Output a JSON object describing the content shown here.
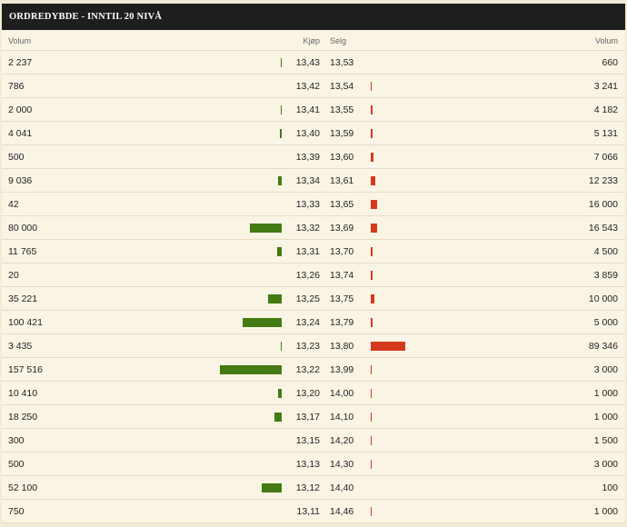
{
  "title": "ORDREDYBDE - INNTIL 20 NIVÅ",
  "headers": {
    "buy_volume": "Volum",
    "bid": "Kjøp",
    "ask": "Selg",
    "sell_volume": "Volum"
  },
  "colors": {
    "buy": "#447b12",
    "sell": "#d63a1e",
    "header_bg": "#1e1e1e",
    "row_bg": "#faf4e5"
  },
  "rows": [
    {
      "buy_volume": "2 237",
      "buy_qty": 2237,
      "bid": "13,43",
      "ask": "13,53",
      "sell_volume": "660",
      "sell_qty": 660
    },
    {
      "buy_volume": "786",
      "buy_qty": 786,
      "bid": "13,42",
      "ask": "13,54",
      "sell_volume": "3 241",
      "sell_qty": 3241
    },
    {
      "buy_volume": "2 000",
      "buy_qty": 2000,
      "bid": "13,41",
      "ask": "13,55",
      "sell_volume": "4 182",
      "sell_qty": 4182
    },
    {
      "buy_volume": "4 041",
      "buy_qty": 4041,
      "bid": "13,40",
      "ask": "13,59",
      "sell_volume": "5 131",
      "sell_qty": 5131
    },
    {
      "buy_volume": "500",
      "buy_qty": 500,
      "bid": "13,39",
      "ask": "13,60",
      "sell_volume": "7 066",
      "sell_qty": 7066
    },
    {
      "buy_volume": "9 036",
      "buy_qty": 9036,
      "bid": "13,34",
      "ask": "13,61",
      "sell_volume": "12 233",
      "sell_qty": 12233
    },
    {
      "buy_volume": "42",
      "buy_qty": 42,
      "bid": "13,33",
      "ask": "13,65",
      "sell_volume": "16 000",
      "sell_qty": 16000
    },
    {
      "buy_volume": "80 000",
      "buy_qty": 80000,
      "bid": "13,32",
      "ask": "13,69",
      "sell_volume": "16 543",
      "sell_qty": 16543
    },
    {
      "buy_volume": "11 765",
      "buy_qty": 11765,
      "bid": "13,31",
      "ask": "13,70",
      "sell_volume": "4 500",
      "sell_qty": 4500
    },
    {
      "buy_volume": "20",
      "buy_qty": 20,
      "bid": "13,26",
      "ask": "13,74",
      "sell_volume": "3 859",
      "sell_qty": 3859
    },
    {
      "buy_volume": "35 221",
      "buy_qty": 35221,
      "bid": "13,25",
      "ask": "13,75",
      "sell_volume": "10 000",
      "sell_qty": 10000
    },
    {
      "buy_volume": "100 421",
      "buy_qty": 100421,
      "bid": "13,24",
      "ask": "13,79",
      "sell_volume": "5 000",
      "sell_qty": 5000
    },
    {
      "buy_volume": "3 435",
      "buy_qty": 3435,
      "bid": "13,23",
      "ask": "13,80",
      "sell_volume": "89 346",
      "sell_qty": 89346
    },
    {
      "buy_volume": "157 516",
      "buy_qty": 157516,
      "bid": "13,22",
      "ask": "13,99",
      "sell_volume": "3 000",
      "sell_qty": 3000
    },
    {
      "buy_volume": "10 410",
      "buy_qty": 10410,
      "bid": "13,20",
      "ask": "14,00",
      "sell_volume": "1 000",
      "sell_qty": 1000
    },
    {
      "buy_volume": "18 250",
      "buy_qty": 18250,
      "bid": "13,17",
      "ask": "14,10",
      "sell_volume": "1 000",
      "sell_qty": 1000
    },
    {
      "buy_volume": "300",
      "buy_qty": 300,
      "bid": "13,15",
      "ask": "14,20",
      "sell_volume": "1 500",
      "sell_qty": 1500
    },
    {
      "buy_volume": "500",
      "buy_qty": 500,
      "bid": "13,13",
      "ask": "14,30",
      "sell_volume": "3 000",
      "sell_qty": 3000
    },
    {
      "buy_volume": "52 100",
      "buy_qty": 52100,
      "bid": "13,12",
      "ask": "14,40",
      "sell_volume": "100",
      "sell_qty": 100
    },
    {
      "buy_volume": "750",
      "buy_qty": 750,
      "bid": "13,11",
      "ask": "14,46",
      "sell_volume": "1 000",
      "sell_qty": 1000
    }
  ]
}
